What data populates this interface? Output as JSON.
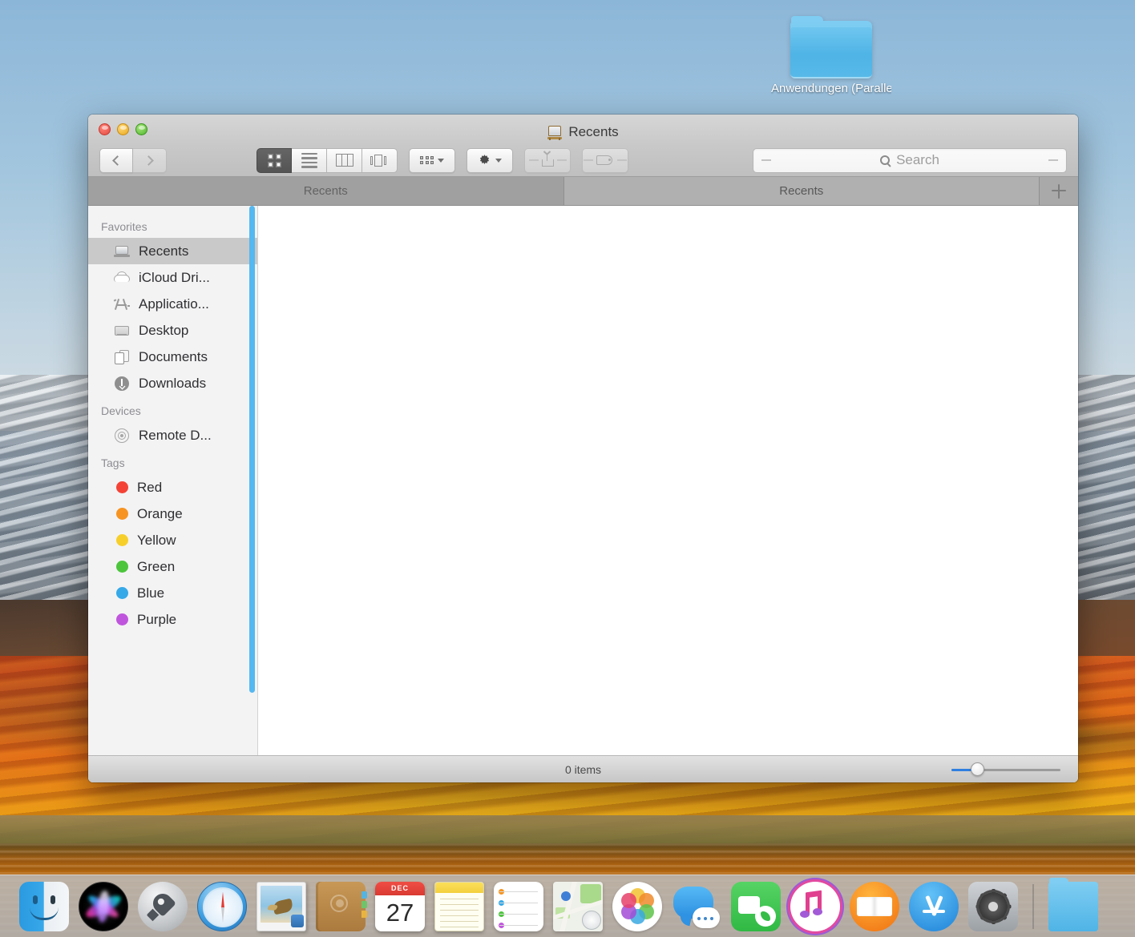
{
  "desktop": {
    "folder": {
      "icon": "folder-icon",
      "label": "Anwendungen (Parallels)"
    }
  },
  "window": {
    "title": "Recents",
    "title_icon": "recents-clock-icon",
    "traffic_lights": {
      "close": "close-button",
      "minimize": "minimize-button",
      "maximize": "maximize-button"
    },
    "toolbar": {
      "back_label": "Back",
      "forward_label": "Forward",
      "view_modes": [
        {
          "name": "icon-view",
          "label": "Icon View",
          "active": true
        },
        {
          "name": "list-view",
          "label": "List View",
          "active": false
        },
        {
          "name": "column-view",
          "label": "Column View",
          "active": false
        },
        {
          "name": "gallery-view",
          "label": "Gallery View",
          "active": false
        }
      ],
      "arrange_label": "Arrange By",
      "action_label": "Action",
      "share_label": "Share",
      "tags_label": "Edit Tags"
    },
    "search": {
      "placeholder": "Search",
      "value": ""
    },
    "tabs": [
      {
        "label": "Recents",
        "active": false
      },
      {
        "label": "Recents",
        "active": true
      }
    ],
    "new_tab_label": "+",
    "sidebar": {
      "sections": [
        {
          "header": "Favorites",
          "items": [
            {
              "label": "Recents",
              "icon": "recents-icon",
              "selected": true
            },
            {
              "label": "iCloud Dri...",
              "icon": "icloud-icon",
              "selected": false
            },
            {
              "label": "Applicatio...",
              "icon": "applications-icon",
              "selected": false
            },
            {
              "label": "Desktop",
              "icon": "desktop-icon",
              "selected": false
            },
            {
              "label": "Documents",
              "icon": "documents-icon",
              "selected": false
            },
            {
              "label": "Downloads",
              "icon": "downloads-icon",
              "selected": false
            }
          ]
        },
        {
          "header": "Devices",
          "items": [
            {
              "label": "Remote D...",
              "icon": "remote-disc-icon",
              "selected": false
            }
          ]
        },
        {
          "header": "Tags",
          "items": [
            {
              "label": "Red",
              "icon": "tag-dot-icon",
              "color": "#f44336",
              "selected": false
            },
            {
              "label": "Orange",
              "icon": "tag-dot-icon",
              "color": "#f79421",
              "selected": false
            },
            {
              "label": "Yellow",
              "icon": "tag-dot-icon",
              "color": "#f7cf2b",
              "selected": false
            },
            {
              "label": "Green",
              "icon": "tag-dot-icon",
              "color": "#4cc53c",
              "selected": false
            },
            {
              "label": "Blue",
              "icon": "tag-dot-icon",
              "color": "#36a9e8",
              "selected": false
            },
            {
              "label": "Purple",
              "icon": "tag-dot-icon",
              "color": "#c055dd",
              "selected": false
            }
          ]
        }
      ]
    },
    "content": {
      "empty": true
    },
    "statusbar": {
      "item_count": "0 items",
      "zoom_value": 18
    }
  },
  "dock": {
    "items": [
      {
        "name": "finder",
        "label": "Finder"
      },
      {
        "name": "siri",
        "label": "Siri"
      },
      {
        "name": "launchpad",
        "label": "Launchpad"
      },
      {
        "name": "safari",
        "label": "Safari"
      },
      {
        "name": "preview",
        "label": "Preview"
      },
      {
        "name": "contacts",
        "label": "Contacts"
      },
      {
        "name": "calendar",
        "label": "Calendar",
        "month": "DEC",
        "day": "27"
      },
      {
        "name": "notes",
        "label": "Notes"
      },
      {
        "name": "reminders",
        "label": "Reminders"
      },
      {
        "name": "maps",
        "label": "Maps"
      },
      {
        "name": "photos",
        "label": "Photos"
      },
      {
        "name": "messages",
        "label": "Messages"
      },
      {
        "name": "facetime",
        "label": "FaceTime"
      },
      {
        "name": "itunes",
        "label": "iTunes"
      },
      {
        "name": "ibooks",
        "label": "iBooks"
      },
      {
        "name": "appstore",
        "label": "App Store"
      },
      {
        "name": "system-preferences",
        "label": "System Preferences"
      },
      {
        "name": "downloads-folder",
        "label": "Downloads"
      }
    ]
  },
  "colors": {
    "accent_blue": "#2f7fe0",
    "scrollbar_blue": "#55b8f0",
    "selection_gray": "#c9c9c9",
    "sidebar_bg": "#f3f3f4",
    "titlebar_bg": "#c8c8c8",
    "tabbar_bg": "#a9a9a9"
  }
}
